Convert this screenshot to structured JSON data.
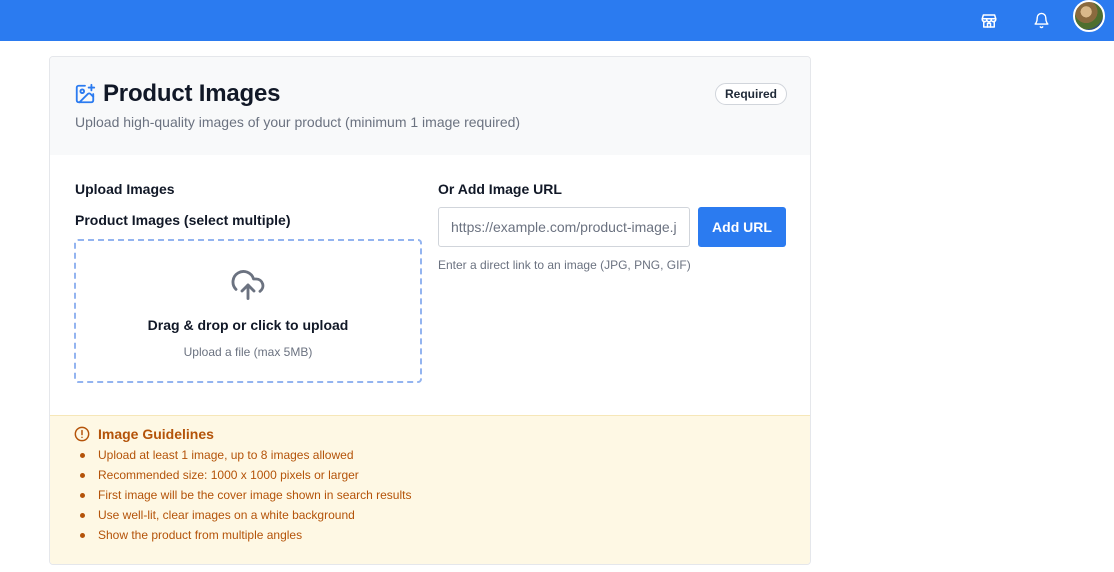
{
  "topbar": {
    "color": "#2b7bf0",
    "icons": [
      "store-icon",
      "bell-icon"
    ],
    "avatar": "user-avatar"
  },
  "card": {
    "icon": "image-plus-icon",
    "title": "Product Images",
    "subtitle": "Upload high-quality images of your product (minimum 1 image required)",
    "badge": "Required"
  },
  "upload": {
    "heading": "Upload Images",
    "field_label": "Product Images (select multiple)",
    "dropzone_icon": "cloud-upload-icon",
    "dropzone_title": "Drag & drop or click to upload",
    "dropzone_hint": "Upload a file (max 5MB)"
  },
  "url": {
    "heading": "Or Add Image URL",
    "placeholder": "https://example.com/product-image.jpg",
    "value": "",
    "button_label": "Add URL",
    "help": "Enter a direct link to an image (JPG, PNG, GIF)"
  },
  "guidelines": {
    "icon": "alert-circle-icon",
    "title": "Image Guidelines",
    "items": [
      "Upload at least 1 image, up to 8 images allowed",
      "Recommended size: 1000 x 1000 pixels or larger",
      "First image will be the cover image shown in search results",
      "Use well-lit, clear images on a white background",
      "Show the product from multiple angles"
    ],
    "color": "#b45309",
    "background": "#fef8e4"
  }
}
